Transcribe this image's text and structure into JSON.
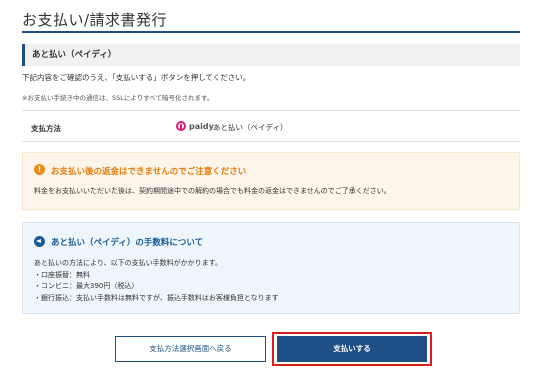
{
  "page": {
    "title": "お支払い/請求書発行"
  },
  "section": {
    "title": "あと払い（ペイディ）"
  },
  "intro": "下記内容をご確認のうえ、「支払いする」ボタンを押してください。",
  "ssl_note": "※お支払い手続き中の通信は、SSLによりすべて暗号化されます。",
  "method": {
    "label": "支払方法",
    "logo_text": "paidy",
    "value": "あと払い（ペイディ）"
  },
  "warning": {
    "icon": "!",
    "title": "お支払い後の返金はできませんのでご注意ください",
    "body": "料金をお支払いいただいた後は、契約期間途中での解約の場合でも料金の返金はできませんのでご了承ください。",
    "color": "#e07d0c"
  },
  "fee": {
    "title": "あと払い（ペイディ）の手数料について",
    "intro": "あと払いの方法により、以下の支払い手数料がかかります。",
    "items": [
      "・口座振替：無料",
      "・コンビニ：最大390円（税込）",
      "・銀行振込：支払い手数料は無料ですが、振込手数料はお客様負担となります"
    ],
    "color": "#1a5b98"
  },
  "buttons": {
    "back": "支払方法選択画面へ戻る",
    "pay": "支払いする"
  },
  "colors": {
    "brand": "#1e4f86",
    "highlight": "#d91d1d",
    "paidy": "#e0197d"
  }
}
